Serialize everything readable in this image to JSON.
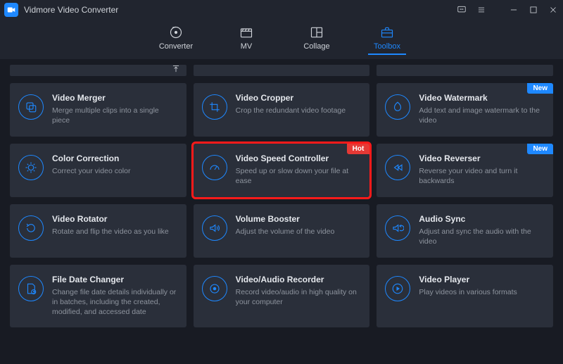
{
  "app": {
    "title": "Vidmore Video Converter"
  },
  "tabs": {
    "converter": "Converter",
    "mv": "MV",
    "collage": "Collage",
    "toolbox": "Toolbox"
  },
  "badges": {
    "hot": "Hot",
    "new": "New"
  },
  "cards": {
    "merger": {
      "title": "Video Merger",
      "desc": "Merge multiple clips into a single piece"
    },
    "cropper": {
      "title": "Video Cropper",
      "desc": "Crop the redundant video footage"
    },
    "watermark": {
      "title": "Video Watermark",
      "desc": "Add text and image watermark to the video"
    },
    "color": {
      "title": "Color Correction",
      "desc": "Correct your video color"
    },
    "speed": {
      "title": "Video Speed Controller",
      "desc": "Speed up or slow down your file at ease"
    },
    "reverser": {
      "title": "Video Reverser",
      "desc": "Reverse your video and turn it backwards"
    },
    "rotator": {
      "title": "Video Rotator",
      "desc": "Rotate and flip the video as you like"
    },
    "volume": {
      "title": "Volume Booster",
      "desc": "Adjust the volume of the video"
    },
    "audiosync": {
      "title": "Audio Sync",
      "desc": "Adjust and sync the audio with the video"
    },
    "filedate": {
      "title": "File Date Changer",
      "desc": "Change file date details individually or in batches, including the created, modified, and accessed date"
    },
    "recorder": {
      "title": "Video/Audio Recorder",
      "desc": "Record video/audio in high quality on your computer"
    },
    "player": {
      "title": "Video Player",
      "desc": "Play videos in various formats"
    }
  }
}
